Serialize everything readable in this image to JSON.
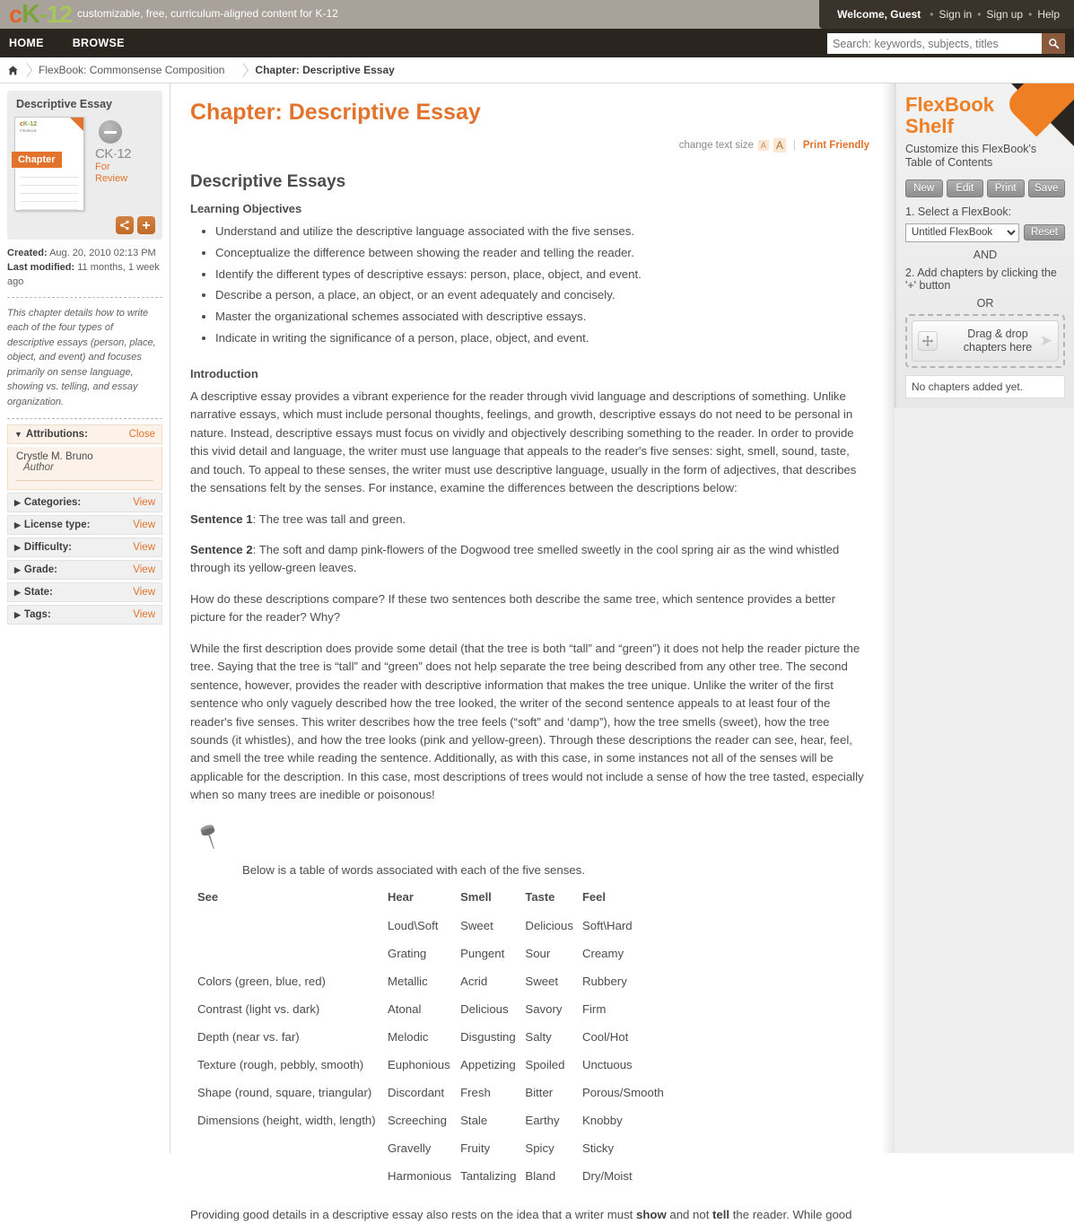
{
  "topbar": {
    "logo_c": "c",
    "logo_k": "K",
    "logo_dash": "-",
    "logo_12": "12",
    "tagline": "customizable, free, curriculum-aligned content for K-12",
    "welcome": "Welcome, Guest",
    "signin": "Sign in",
    "signup": "Sign up",
    "help": "Help",
    "sep": "•"
  },
  "nav": {
    "home": "HOME",
    "browse": "BROWSE",
    "search_placeholder": "Search: keywords, subjects, titles",
    "search_value": "",
    "search_icon": "search-icon"
  },
  "breadcrumb": {
    "home_icon": "home-icon",
    "items": [
      {
        "label": "FlexBook: Commonsense Composition",
        "current": false
      },
      {
        "label": "Chapter: Descriptive Essay",
        "current": true
      }
    ]
  },
  "sidebar": {
    "card_title": "Descriptive Essay",
    "book_logo_c": "c",
    "book_logo_k": "K-12",
    "book_flexbook": "FlexBook",
    "book_chapter_tag": "Chapter",
    "status_name": "CK·12",
    "status_line1": "For",
    "status_line2": "Review",
    "share_icon": "share-icon",
    "add_icon": "plus-icon",
    "created_label": "Created:",
    "created_value": "Aug. 20, 2010 02:13 PM",
    "modified_label": "Last modified:",
    "modified_value": "11 months, 1 week ago",
    "description": "This chapter details how to write each of the four types of descriptive essays (person, place, object, and event) and focuses primarily on sense language, showing vs. telling, and essay organization.",
    "attributions": {
      "label": "Attributions:",
      "action": "Close",
      "author_name": "Crystle M. Bruno",
      "author_role": "Author"
    },
    "sections": [
      {
        "label": "Categories:",
        "action": "View"
      },
      {
        "label": "License type:",
        "action": "View"
      },
      {
        "label": "Difficulty:",
        "action": "View"
      },
      {
        "label": "Grade:",
        "action": "View"
      },
      {
        "label": "State:",
        "action": "View"
      },
      {
        "label": "Tags:",
        "action": "View"
      }
    ]
  },
  "main": {
    "chapter_title": "Chapter: Descriptive Essay",
    "change_text_size": "change text size",
    "size_small": "A",
    "size_large": "A",
    "divider": "|",
    "print_friendly": "Print Friendly",
    "section_title": "Descriptive Essays",
    "objectives_heading": "Learning Objectives",
    "objectives": [
      "Understand and utilize the descriptive language associated with the five senses.",
      "Conceptualize the difference between showing the reader and telling the reader.",
      "Identify the different types of descriptive essays: person, place, object, and event.",
      "Describe a person, a place, an object, or an event adequately and concisely.",
      "Master the organizational schemes associated with descriptive essays.",
      "Indicate in writing the significance of a person, place, object, and event."
    ],
    "intro_heading": "Introduction",
    "intro_paragraph": "A descriptive essay provides a vibrant experience for the reader through vivid language and descriptions of something. Unlike narrative essays, which must include personal thoughts, feelings, and growth, descriptive essays do not need to be personal in nature. Instead, descriptive essays must focus on vividly and objectively describing something to the reader. In order to provide this vivid detail and language, the writer must use language that appeals to the reader's five senses: sight, smell, sound, taste, and touch. To appeal to these senses, the writer must use descriptive language, usually in the form of adjectives, that describes the sensations felt by the senses. For instance, examine the differences between the descriptions below:",
    "sentence1_label": "Sentence 1",
    "sentence1_text": ": The tree was tall and green.",
    "sentence2_label": "Sentence 2",
    "sentence2_text": ": The soft and damp pink-flowers of the Dogwood tree smelled sweetly in the cool spring air as the wind whistled through its yellow-green leaves.",
    "compare_paragraph": "How do these descriptions compare? If these two sentences both describe the same tree, which sentence provides a better picture for the reader? Why?",
    "analysis_paragraph": "While the first description does provide some detail (that the tree is both “tall” and “green”) it does not help the reader picture the tree. Saying that the tree is “tall” and “green” does not help separate the tree being described from any other tree. The second sentence, however, provides the reader with descriptive information that makes the tree unique. Unlike the writer of the first sentence who only vaguely described how the tree looked, the writer of the second sentence appeals to at least four of the reader's five senses. This writer describes how the tree feels (“soft” and ‘damp”), how the tree smells (sweet), how the tree sounds (it whistles), and how the tree looks (pink and yellow-green). Through these descriptions the reader can see, hear, feel, and smell the tree while reading the sentence. Additionally, as with this case, in some instances not all of the senses will be applicable for the description. In this case, most descriptions of trees would not include a sense of how the tree tasted, especially when so many trees are inedible or poisonous!",
    "pin_icon": "pushpin-icon",
    "table_caption": "Below is a table of words associated with each of the five senses.",
    "table": {
      "headers": [
        "See",
        "Hear",
        "Smell",
        "Taste",
        "Feel"
      ],
      "rows": [
        [
          "",
          "Loud\\Soft",
          "Sweet",
          "Delicious",
          "Soft\\Hard"
        ],
        [
          "",
          "Grating",
          "Pungent",
          "Sour",
          "Creamy"
        ],
        [
          "Colors (green, blue, red)",
          "Metallic",
          "Acrid",
          "Sweet",
          "Rubbery"
        ],
        [
          "Contrast (light vs. dark)",
          "Atonal",
          "Delicious",
          "Savory",
          "Firm"
        ],
        [
          "Depth (near vs. far)",
          "Melodic",
          "Disgusting",
          "Salty",
          "Cool/Hot"
        ],
        [
          "Texture (rough, pebbly, smooth)",
          "Euphonious",
          "Appetizing",
          "Spoiled",
          "Unctuous"
        ],
        [
          "Shape (round, square, triangular)",
          "Discordant",
          "Fresh",
          "Bitter",
          "Porous/Smooth"
        ],
        [
          "Dimensions (height, width, length)",
          "Screeching",
          "Stale",
          "Earthy",
          "Knobby"
        ],
        [
          "",
          "Gravelly",
          "Fruity",
          "Spicy",
          "Sticky"
        ],
        [
          "",
          "Harmonious",
          "Tantalizing",
          "Bland",
          "Dry/Moist"
        ]
      ]
    },
    "closing_paragraph_part1": "Providing good details in a descriptive essay also rests on the idea that a writer must ",
    "closing_bold1": "show",
    "closing_paragraph_part2": " and not ",
    "closing_bold2": "tell",
    "closing_paragraph_part3": " the reader. While good"
  },
  "shelf": {
    "title_line1": "FlexBook",
    "title_line2": "Shelf",
    "subtitle": "Customize this FlexBook's Table of Contents",
    "buttons": [
      "New",
      "Edit",
      "Print",
      "Save"
    ],
    "step1": "1. Select a FlexBook:",
    "select_value": "Untitled FlexBook",
    "select_options": [
      "Untitled FlexBook"
    ],
    "reset": "Reset",
    "and": "AND",
    "step2": "2. Add chapters by clicking the '+' button",
    "or": "OR",
    "drop_line1": "Drag & drop",
    "drop_line2": "chapters here",
    "move_icon": "move-icon",
    "chevron_icon": "chevron-right-icon",
    "empty_message": "No chapters added yet."
  },
  "colors": {
    "accent_orange": "#e2732c",
    "shelf_orange": "#ee7f23",
    "nav_dark": "#2b2520",
    "topbar_tan": "#a9a29a"
  }
}
